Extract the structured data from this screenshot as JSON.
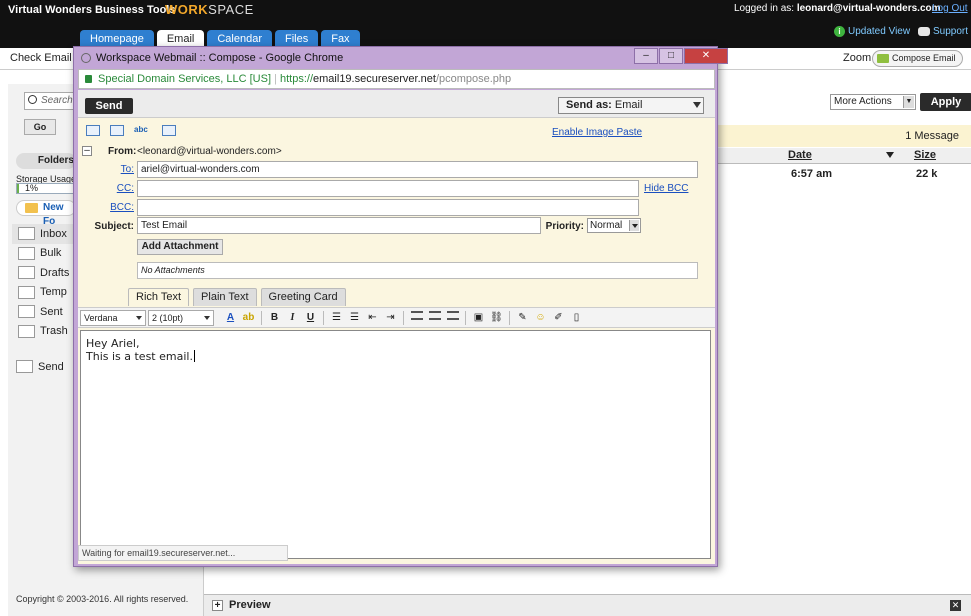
{
  "app": {
    "brand": "Virtual Wonders Business Tools",
    "logo_work": "WORK",
    "logo_space": "SPACE",
    "logged_in_label": "Logged in as:",
    "user": "leonard@virtual-wonders.com",
    "logout": "Log Out",
    "updated_view": "Updated View",
    "support": "Support",
    "tabs": [
      "Homepage",
      "Email",
      "Calendar",
      "Files",
      "Fax"
    ],
    "active_tab": "Email"
  },
  "toolbar": {
    "check_email": "Check Email",
    "zoom": "Zoom",
    "compose_email": "Compose Email"
  },
  "sidebar": {
    "search_placeholder": "Search",
    "go": "Go",
    "folders_tab": "Folders",
    "storage_usage": "Storage Usage",
    "storage_percent": "1%",
    "storage_fraction": 0.01,
    "new_folder": "New Fo",
    "folders": [
      "Inbox",
      "Bulk",
      "Drafts",
      "Temp",
      "Sent",
      "Trash"
    ],
    "send_queue": "Send",
    "copyright": "Copyright © 2003-2016. All rights reserved."
  },
  "message_list": {
    "more_actions": "More Actions",
    "apply": "Apply",
    "count": "1 Message",
    "col_date": "Date",
    "col_size": "Size",
    "rows": [
      {
        "date": "6:57 am",
        "size": "22 k"
      }
    ]
  },
  "preview": {
    "label": "Preview"
  },
  "popup": {
    "title": "Workspace Webmail :: Compose - Google Chrome",
    "secure_label": "Special Domain Services, LLC [US]",
    "url_scheme": "https://",
    "url_host": "email19.secureserver.net",
    "url_path": "/pcompose.php",
    "status": "Waiting for email19.secureserver.net..."
  },
  "compose": {
    "send": "Send",
    "send_as_label": "Send as:",
    "send_as_value": "Email",
    "enable_image_paste": "Enable Image Paste",
    "from_label": "From:",
    "from_value": "<leonard@virtual-wonders.com>",
    "to_label": "To:",
    "to_value": "ariel@virtual-wonders.com",
    "cc_label": "CC:",
    "cc_value": "",
    "bcc_label": "BCC:",
    "bcc_value": "",
    "hide_bcc": "Hide BCC",
    "subject_label": "Subject:",
    "subject_value": "Test Email",
    "priority_label": "Priority:",
    "priority_value": "Normal",
    "add_attachment": "Add Attachment",
    "no_attachments": "No Attachments",
    "editor_tabs": [
      "Rich Text",
      "Plain Text",
      "Greeting Card"
    ],
    "font": "Verdana",
    "size": "2 (10pt)",
    "body_line1": "Hey Ariel,",
    "body_line2": "This is a test email."
  }
}
